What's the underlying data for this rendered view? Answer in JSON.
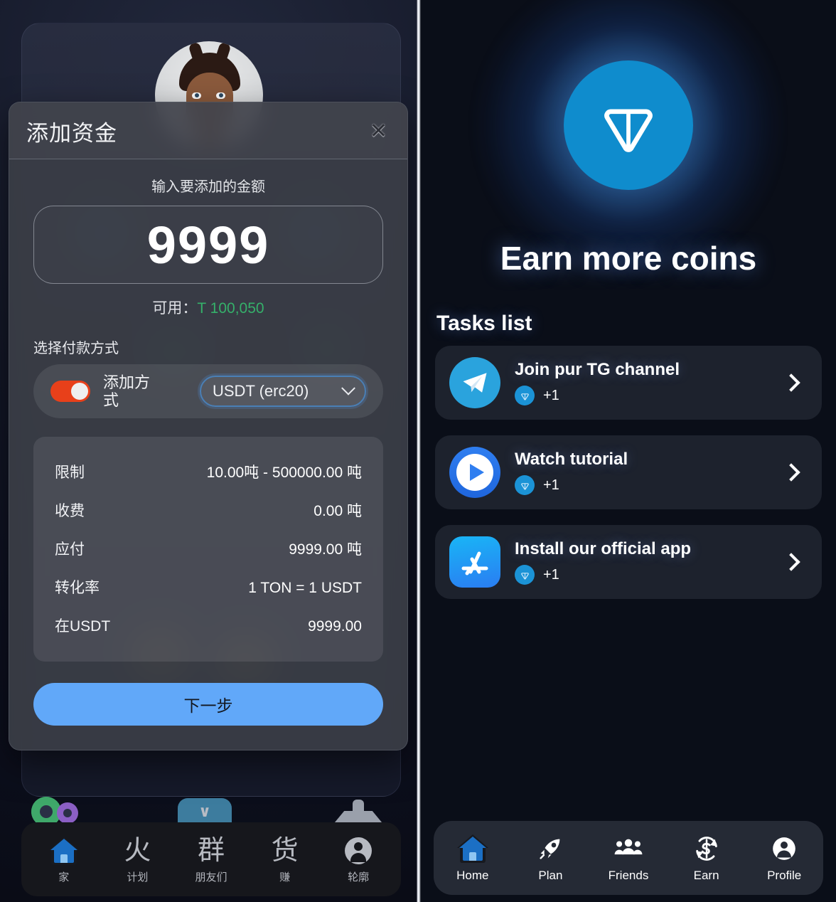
{
  "left": {
    "modal": {
      "title": "添加资金",
      "close_icon": "close-icon",
      "amount_label": "输入要添加的金额",
      "amount_value": "9999",
      "available_label": "可用：",
      "available_amount": "T 100,050",
      "payment_section_label": "选择付款方式",
      "toggle_on": true,
      "method_label": "添加方式",
      "method_selected": "USDT (erc20)",
      "info_rows": [
        {
          "key": "限制",
          "value": "10.00吨 - 500000.00 吨"
        },
        {
          "key": "收费",
          "value": "0.00 吨"
        },
        {
          "key": "应付",
          "value": "9999.00 吨"
        },
        {
          "key": "转化率",
          "value": "1 TON = 1 USDT"
        },
        {
          "key": "在USDT",
          "value": "9999.00"
        }
      ],
      "next_button": "下一步"
    },
    "nav": [
      {
        "glyph": "home",
        "label": "家",
        "icon_name": "home-icon",
        "active": true
      },
      {
        "glyph": "火",
        "label": "计划",
        "icon_name": "plan-icon",
        "active": false
      },
      {
        "glyph": "群",
        "label": "朋友们",
        "icon_name": "friends-icon",
        "active": false
      },
      {
        "glyph": "货",
        "label": "赚",
        "icon_name": "earn-icon",
        "active": false
      },
      {
        "glyph": "person",
        "label": "轮廓",
        "icon_name": "profile-icon",
        "active": false
      }
    ]
  },
  "right": {
    "hero_title": "Earn more coins",
    "coin_icon": "ton-coin-icon",
    "tasks_heading": "Tasks list",
    "tasks": [
      {
        "title": "Join pur TG channel",
        "reward": "+1",
        "icon": "telegram-icon",
        "arrow": "chevron-right-icon"
      },
      {
        "title": "Watch tutorial",
        "reward": "+1",
        "icon": "play-circle-icon",
        "arrow": "chevron-right-icon"
      },
      {
        "title": "Install our official app",
        "reward": "+1",
        "icon": "app-store-icon",
        "arrow": "chevron-right-icon"
      }
    ],
    "nav": [
      {
        "label": "Home",
        "icon_name": "home-icon",
        "active": true
      },
      {
        "label": "Plan",
        "icon_name": "rocket-icon",
        "active": false
      },
      {
        "label": "Friends",
        "icon_name": "people-icon",
        "active": false
      },
      {
        "label": "Earn",
        "icon_name": "coin-refresh-icon",
        "active": false
      },
      {
        "label": "Profile",
        "icon_name": "person-icon",
        "active": false
      }
    ]
  },
  "colors": {
    "accent_blue": "#61a8f9",
    "ton_blue": "#0f8ccd",
    "toggle_orange": "#e8401a",
    "available_green": "#35b06a",
    "right_bg": "#0a0e18",
    "card_bg": "#1d222d"
  }
}
